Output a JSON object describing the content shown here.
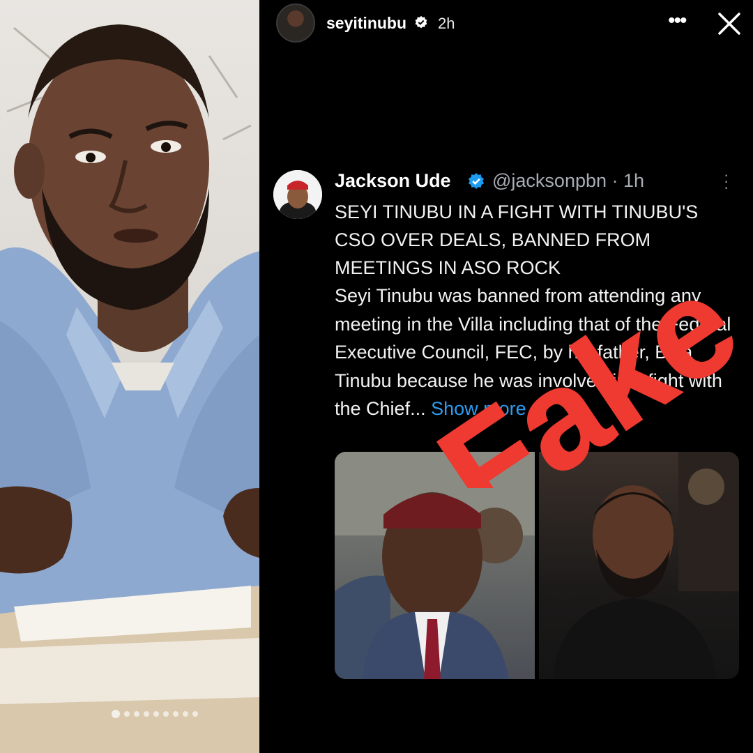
{
  "story": {
    "username": "seyitinubu",
    "time": "2h",
    "icons": {
      "verified": "verified-badge-icon",
      "more": "more-options-icon",
      "close": "close-icon"
    }
  },
  "tweet": {
    "author_name": "Jackson Ude",
    "handle_time": "@jacksonpbn · 1h",
    "headline_lines": [
      "SEYI TINUBU IN A FIGHT WITH TINUBU'S",
      "CSO OVER DEALS, BANNED FROM",
      "MEETINGS IN ASO ROCK"
    ],
    "body": "Seyi Tinubu was banned from attending any meeting in the Villa including that of the Federal Executive Council, FEC, by his father, Bola Tinubu because he was involved in a fight with the Chief...",
    "show_more": "Show more",
    "verified_color": "#1d9bf0"
  },
  "overlay": {
    "stamp_text": "Fake",
    "stamp_color": "#ee3a30"
  },
  "colors": {
    "background": "#000000",
    "link": "#2d9bf0",
    "text": "#f2f2f2",
    "muted": "#a8adb3"
  }
}
